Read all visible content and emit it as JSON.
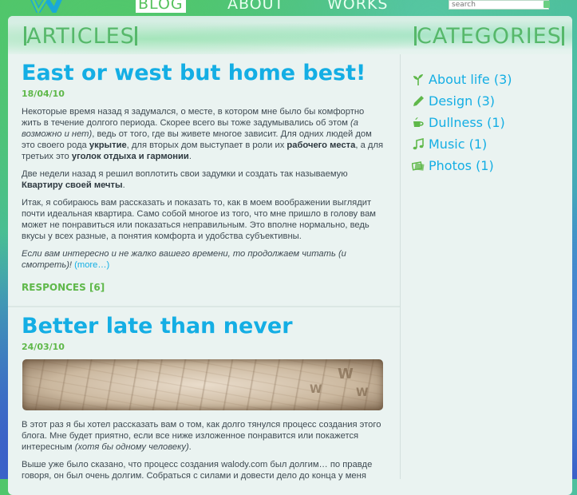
{
  "nav": {
    "items": [
      {
        "label": "BLOG",
        "active": true
      },
      {
        "label": "ABOUT",
        "active": false
      },
      {
        "label": "WORKS",
        "active": false
      }
    ],
    "search_placeholder": "search"
  },
  "articles_heading": "ARTICLES",
  "categories_heading": "CATEGORIES",
  "posts": [
    {
      "title": "East or west but home best!",
      "date": "18/04/10",
      "p1_a": "Некоторые время назад я задумался, о месте, в котором мне было бы комфортно жить в течение долгого периода. Скорее всего вы тоже задумывались об этом ",
      "p1_i": "(а возможно и нет)",
      "p1_b": ", ведь от того, где вы живете многое зависит. Для одних людей дом это своего рода ",
      "p1_bold1": "укрытие",
      "p1_c": ", для вторых дом выступает в роли их ",
      "p1_bold2": "рабочего места",
      "p1_d": ", а для третьих это ",
      "p1_bold3": "уголок отдыха и гармонии",
      "p1_e": ".",
      "p2_a": "Две недели назад я решил воплотить свои задумки и создать так называемую ",
      "p2_bold": "Квартиру своей мечты",
      "p2_b": ".",
      "p3": "Итак, я собираюсь вам рассказать и показать то, как в моем воображении выглядит почти идеальная квартира. Само собой многое из того, что мне пришло в голову вам может не понравиться или показаться неправильным. Это вполне нормально, ведь вкусы у всех разные, а понятия комфорта и удобства субъективны.",
      "p4_i": "Если вам интересно и не жалко вашего времени, то продолжаем читать (и смотреть)!",
      "more": "(more…)",
      "responses": "RESPONCES [6]"
    },
    {
      "title": "Better late than never",
      "date": "24/03/10",
      "p1_a": "В этот раз я бы хотел рассказать вам о том, как долго тянулся процесс создания этого блога. Мне будет приятно, если все ниже изложенное понравится или покажется интересным ",
      "p1_i": "(хотя бы одному человеку)",
      "p1_b": ".",
      "p2": "Выше уже было сказано, что процесс создания walody.com был долгим… по правде говоря, он был очень долгим. Собраться с силами и довести дело до конца у меня"
    }
  ],
  "categories": [
    {
      "label": "About life (3)",
      "icon": "sprout-icon"
    },
    {
      "label": "Design (3)",
      "icon": "pencil-icon"
    },
    {
      "label": "Dullness (1)",
      "icon": "coffee-cup-icon"
    },
    {
      "label": "Music (1)",
      "icon": "music-note-icon"
    },
    {
      "label": "Photos (1)",
      "icon": "photos-icon"
    }
  ],
  "colors": {
    "accent_blue": "#14aee4",
    "accent_green": "#5fb84a",
    "panel_bg": "#eaf3f1"
  }
}
